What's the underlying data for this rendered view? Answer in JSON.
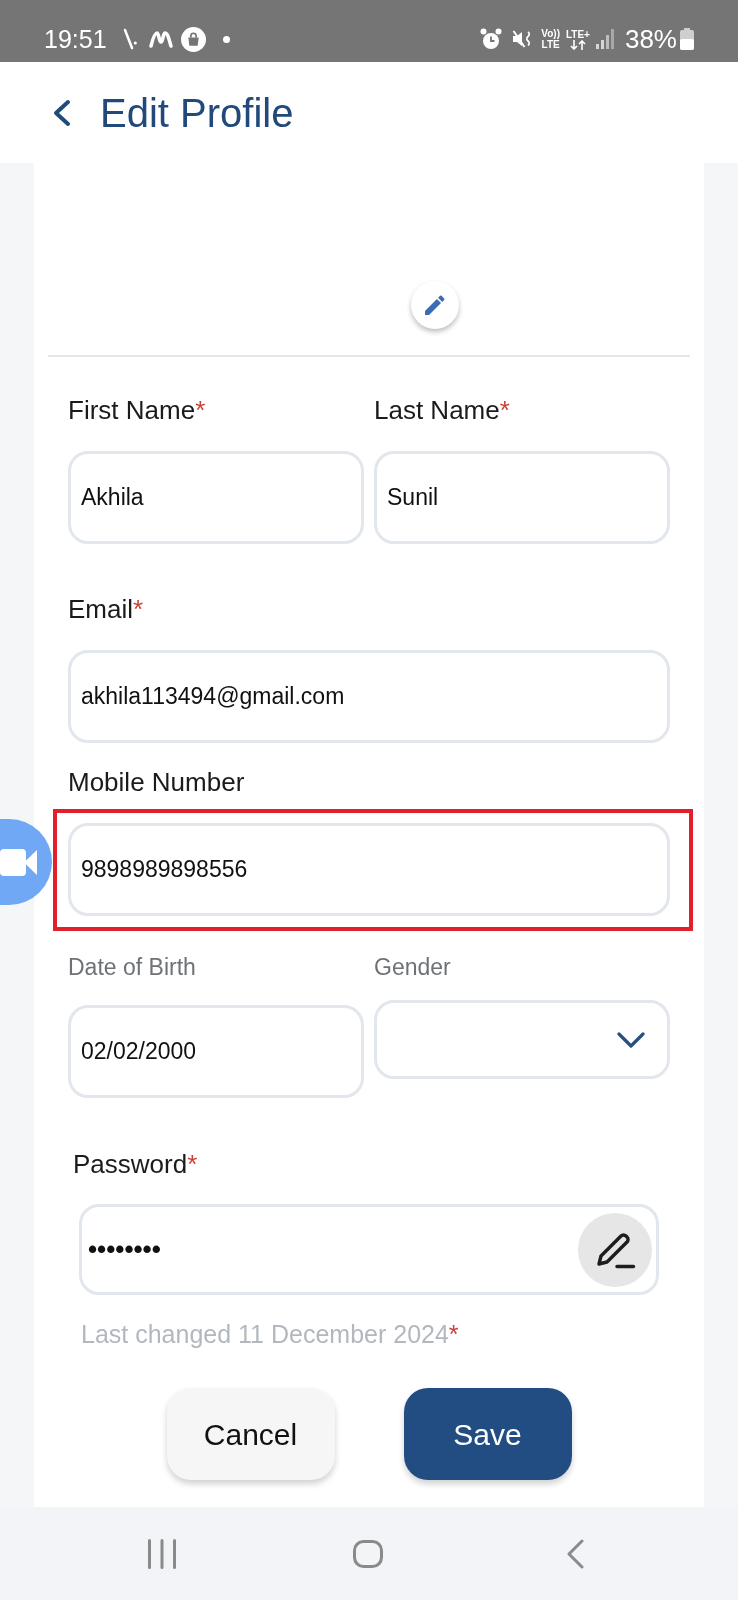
{
  "status_bar": {
    "time": "19:51",
    "volte_top": "Vo))",
    "volte_bottom": "LTE",
    "network": "LTE+",
    "battery_text": "38%"
  },
  "header": {
    "title": "Edit Profile"
  },
  "form": {
    "rows": [
      {
        "fields": [
          {
            "kind": "text",
            "label": "First Name",
            "required_mark": "*",
            "value": "Akhila",
            "highlighted": false
          },
          {
            "kind": "text",
            "label": "Last Name",
            "required_mark": "*",
            "value": "Sunil",
            "highlighted": false
          }
        ]
      },
      {
        "fields": [
          {
            "kind": "text",
            "label": "Email",
            "required_mark": "*",
            "value": "akhila113494@gmail.com",
            "highlighted": false
          }
        ]
      },
      {
        "fields": [
          {
            "kind": "text",
            "label": "Mobile Number",
            "value": "9898989898556",
            "highlighted": true
          }
        ]
      },
      {
        "fields": [
          {
            "kind": "date",
            "label": "Date of Birth",
            "value": "02/02/2000",
            "highlighted": false
          },
          {
            "kind": "select",
            "label": "Gender",
            "highlighted": false
          }
        ]
      },
      {
        "fields": [
          {
            "kind": "password",
            "label": "Password",
            "required_mark": "*",
            "value": "••••••••",
            "note": "Last changed 11 December 2024",
            "note_mark": "*",
            "highlighted": false
          }
        ]
      }
    ]
  },
  "buttons": [
    {
      "kind": "secondary",
      "label": "Cancel"
    },
    {
      "kind": "primary",
      "label": "Save"
    }
  ]
}
